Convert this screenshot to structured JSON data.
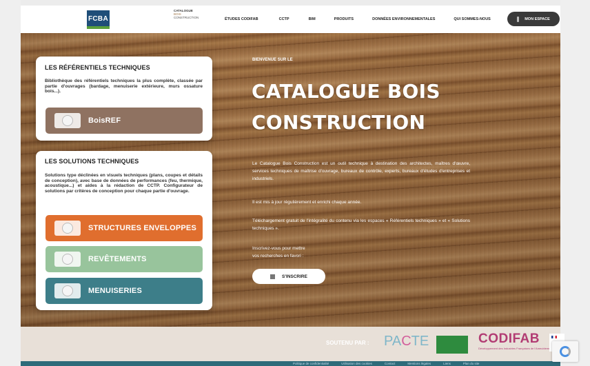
{
  "header": {
    "logo_fcba": "FCBA",
    "logo_catalogue": [
      "CATALOGUE",
      "BOIS",
      "CONSTRUCTION"
    ],
    "nav": [
      "ÉTUDES CODIFAB",
      "CCTP",
      "BIM",
      "PRODUITS",
      "DONNÉES ENVIRONNEMENTALES",
      "QUI SOMMES-NOUS"
    ],
    "account_button": "MON ESPACE"
  },
  "referentiels": {
    "title": "LES RÉFÉRENTIELS TECHNIQUES",
    "description": "Bibliothèque des référentiels techniques la plus complète, classée par partie d'ouvrages (bardage, menuiserie extérieure, murs ossature bois...).",
    "button": "BoisREF"
  },
  "solutions": {
    "title": "LES SOLUTIONS TECHNIQUES",
    "description": "Solutions type déclinées en visuels techniques (plans, coupes et détails de conception), avec base de données de performances (feu, thermique, acoustique...) et aides à la rédaction de CCTP. Configurateur de solutions par critères de conception pour chaque partie d'ouvrage.",
    "buttons": [
      "STRUCTURES ENVELOPPES",
      "REVÊTEMENTS",
      "MENUISERIES"
    ]
  },
  "hero": {
    "welcome": "BIENVENUE SUR LE",
    "title_line1": "CATALOGUE BOIS",
    "title_line2": "CONSTRUCTION",
    "paragraph1": "Le Catalogue Bois Construction est un outil technique à destination des architectes, maîtres d'œuvre, services techniques de maîtrise d'ouvrage, bureaux de contrôle, experts, bureaux d'études d'entreprises et industriels.",
    "paragraph2": "Il est mis à jour régulièrement et enrichi chaque année.",
    "paragraph3": "Téléchargement gratuit de l'intégralité du contenu via les espaces « Référentiels techniques » et « Solutions techniques ».",
    "paragraph4_line1": "Inscrivez-vous pour mettre",
    "paragraph4_line2": "vos recherches en favori :",
    "signup_button": "S'INSCRIRE"
  },
  "sponsors": {
    "label": "SOUTENU PAR :",
    "pacte": [
      "PA",
      "C",
      "TE"
    ],
    "codifab": "CODIFAB",
    "codifab_sub": "Développement des Industries Françaises de l'Ameublement et du Bois"
  },
  "footer": {
    "links": [
      "Politique de confidentialité",
      "Utilisation des cookies",
      "Contact",
      "Mentions légales",
      "Liens",
      "Plan du site"
    ]
  },
  "colors": {
    "boisref": "#8f7261",
    "structures": "#e06e2e",
    "revetements": "#98c49c",
    "menuiseries": "#3d7e89"
  }
}
